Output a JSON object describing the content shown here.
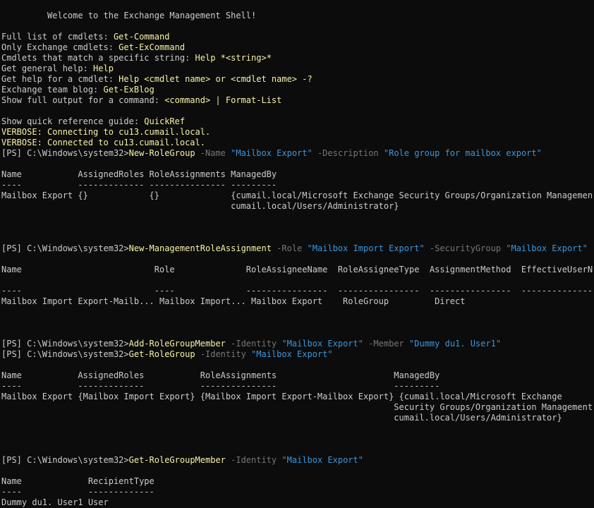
{
  "colors": {
    "background": "#0c0c0c",
    "output": "#cccccc",
    "command": "#f9f1a5",
    "parameter": "#767676",
    "string": "#3a96dd"
  },
  "prompt": "[PS] C:\\Windows\\system32>",
  "welcome": {
    "title": "         Welcome to the Exchange Management Shell!",
    "tips": [
      {
        "label": "Full list of cmdlets: ",
        "cmd": "Get-Command"
      },
      {
        "label": "Only Exchange cmdlets: ",
        "cmd": "Get-ExCommand"
      },
      {
        "label": "Cmdlets that match a specific string: ",
        "cmd": "Help *<string>*"
      },
      {
        "label": "Get general help: ",
        "cmd": "Help"
      },
      {
        "label": "Get help for a cmdlet: ",
        "cmd": "Help <cmdlet name> or <cmdlet name> -?"
      },
      {
        "label": "Exchange team blog: ",
        "cmd": "Get-ExBlog"
      },
      {
        "label": "Show full output for a command: ",
        "cmd": "<command> | Format-List"
      }
    ],
    "quickref": {
      "label": "Show quick reference guide: ",
      "cmd": "QuickRef"
    },
    "verbose": [
      "VERBOSE: Connecting to cu13.cumail.local.",
      "VERBOSE: Connected to cu13.cumail.local."
    ]
  },
  "commands": [
    {
      "cmdlet": "New-RoleGroup",
      "params": [
        {
          "name": " -Name ",
          "value": "\"Mailbox Export\""
        },
        {
          "name": " -Description ",
          "value": "\"Role group for mailbox export\""
        }
      ],
      "output": [
        "",
        "Name           AssignedRoles RoleAssignments ManagedBy",
        "----           ------------- --------------- ---------",
        "Mailbox Export {}            {}              {cumail.local/Microsoft Exchange Security Groups/Organization Management,",
        "                                             cumail.local/Users/Administrator}",
        "",
        "",
        ""
      ]
    },
    {
      "cmdlet": "New-ManagementRoleAssignment",
      "params": [
        {
          "name": " -Role ",
          "value": "\"Mailbox Import Export\""
        },
        {
          "name": " -SecurityGroup ",
          "value": "\"Mailbox Export\""
        }
      ],
      "output": [
        "",
        "Name                          Role              RoleAssigneeName  RoleAssigneeType  AssignmentMethod  EffectiveUserName",
        "",
        "----                          ----              ----------------  ----------------  ----------------  ----------------",
        "Mailbox Import Export-Mailb... Mailbox Import... Mailbox Export    RoleGroup         Direct",
        "",
        "",
        ""
      ]
    },
    {
      "cmdlet": "Add-RoleGroupMember",
      "params": [
        {
          "name": " -Identity ",
          "value": "\"Mailbox Export\""
        },
        {
          "name": " -Member ",
          "value": "\"Dummy du1. User1\""
        }
      ],
      "output": []
    },
    {
      "cmdlet": "Get-RoleGroup",
      "params": [
        {
          "name": " -Identity ",
          "value": "\"Mailbox Export\""
        }
      ],
      "output": [
        "",
        "Name           AssignedRoles           RoleAssignments                       ManagedBy",
        "----           -------------           ---------------                       ---------",
        "Mailbox Export {Mailbox Import Export} {Mailbox Import Export-Mailbox Export} {cumail.local/Microsoft Exchange",
        "                                                                             Security Groups/Organization Management,",
        "                                                                             cumail.local/Users/Administrator}",
        "",
        "",
        ""
      ]
    },
    {
      "cmdlet": "Get-RoleGroupMember",
      "params": [
        {
          "name": " -Identity ",
          "value": "\"Mailbox Export\""
        }
      ],
      "output": [
        "",
        "Name             RecipientType",
        "----             -------------",
        "Dummy du1. User1 User"
      ]
    }
  ]
}
